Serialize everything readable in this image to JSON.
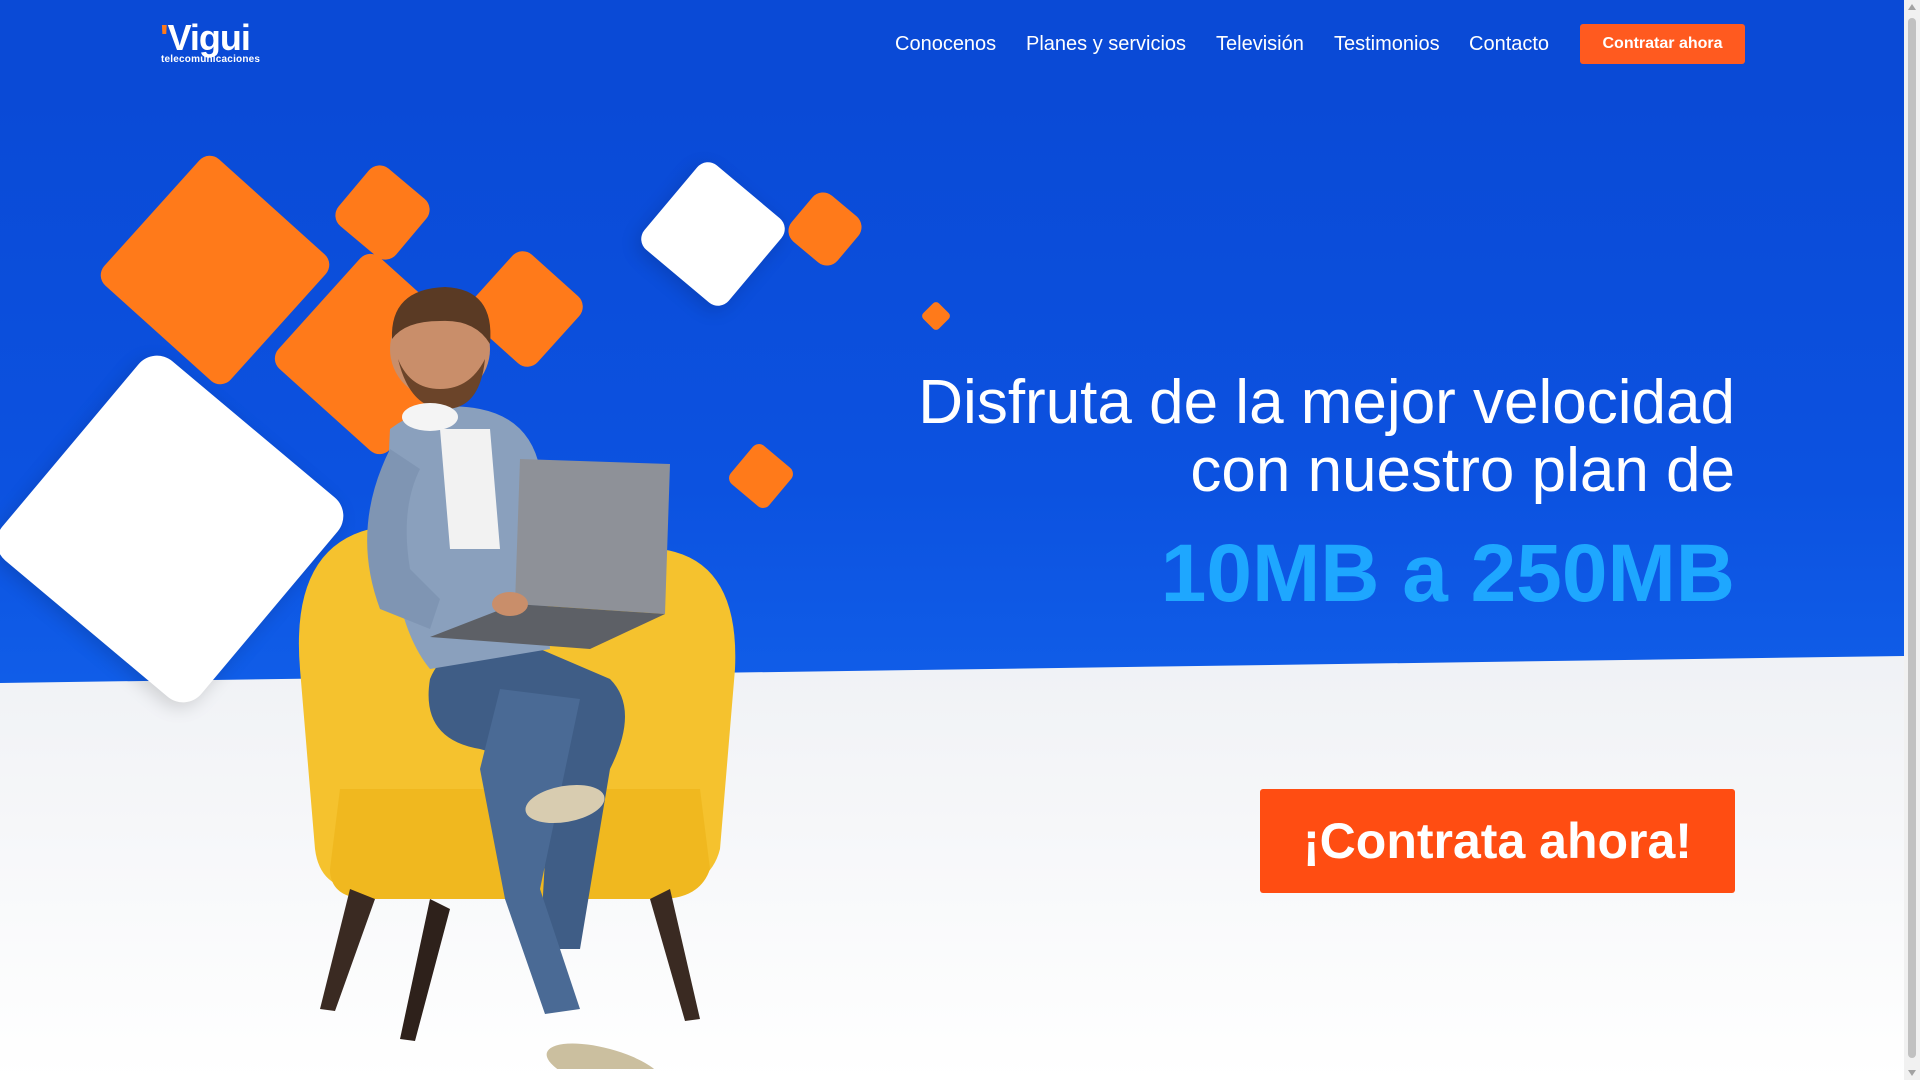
{
  "brand": {
    "name": "Vigui",
    "tagline": "telecomunicaciones",
    "accent": "#ff7a1a"
  },
  "nav": {
    "items": [
      {
        "label": "Conocenos"
      },
      {
        "label": "Planes y servicios"
      },
      {
        "label": "Televisión"
      },
      {
        "label": "Testimonios"
      },
      {
        "label": "Contacto"
      }
    ],
    "cta_label": "Contratar ahora"
  },
  "hero": {
    "headline_line1": "Disfruta de la mejor velocidad",
    "headline_line2": "con nuestro plan de",
    "speed": "10MB a 250MB",
    "cta_label": "¡Contrata ahora!"
  },
  "colors": {
    "header_bg": "#0a4ad6",
    "hero_bg": "#0c52e0",
    "cta": "#ff4d12",
    "speed_text": "#1ea7ff"
  }
}
